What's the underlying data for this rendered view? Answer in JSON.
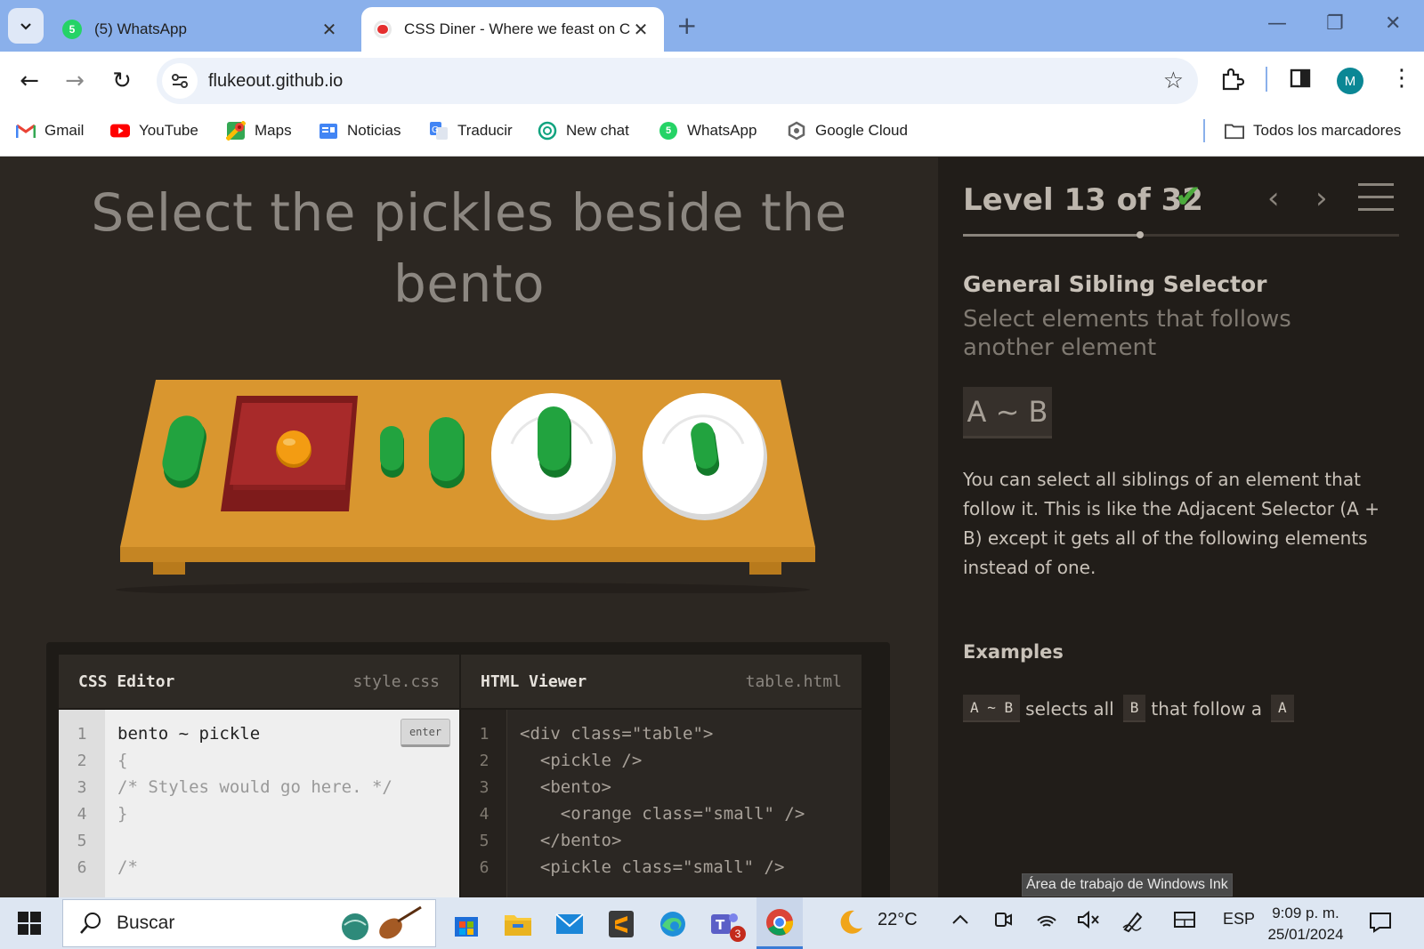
{
  "browser": {
    "tabs": [
      {
        "title": "(5) WhatsApp",
        "active": false,
        "badge": "5"
      },
      {
        "title": "CSS Diner - Where we feast on CSS Selectors!",
        "active": true
      }
    ],
    "new_tab_label": "+",
    "url": "flukeout.github.io",
    "profile_initial": "M",
    "bookmarks": [
      {
        "label": "Gmail",
        "icon": "gmail-icon"
      },
      {
        "label": "YouTube",
        "icon": "youtube-icon"
      },
      {
        "label": "Maps",
        "icon": "maps-icon"
      },
      {
        "label": "Noticias",
        "icon": "news-icon"
      },
      {
        "label": "Traducir",
        "icon": "translate-icon"
      },
      {
        "label": "New chat",
        "icon": "chatgpt-icon"
      },
      {
        "label": "WhatsApp",
        "icon": "whatsapp-icon"
      },
      {
        "label": "Google Cloud",
        "icon": "google-cloud-icon"
      }
    ],
    "all_bookmarks_label": "Todos los marcadores"
  },
  "game": {
    "order_text": "Select the pickles beside the bento",
    "table_items": [
      "pickle",
      "bento",
      "orange small",
      "pickle small",
      "pickle",
      "plate",
      "pickle",
      "plate",
      "pickle small"
    ],
    "editor": {
      "css_title": "CSS Editor",
      "css_file": "style.css",
      "html_title": "HTML Viewer",
      "html_file": "table.html",
      "enter_label": "enter",
      "css_lines": [
        "bento ~ pickle",
        "{",
        "/* Styles would go here. */",
        "}",
        "",
        "/*"
      ],
      "css_numbers": [
        "1",
        "2",
        "3",
        "4",
        "5",
        "6"
      ],
      "html_lines": [
        "<div class=\"table\">",
        "  <pickle />",
        "  <bento>",
        "    <orange class=\"small\" />",
        "  </bento>",
        "  <pickle class=\"small\" />"
      ],
      "html_numbers": [
        "1",
        "2",
        "3",
        "4",
        "5",
        "6"
      ]
    },
    "sidebar": {
      "level_text": "Level 13 of 32",
      "level_current": 13,
      "level_total": 32,
      "completed": true,
      "selector_name": "General Sibling Selector",
      "selector_title": "Select elements that follows another element",
      "syntax": "A ~ B",
      "hint": "You can select all siblings of an element that follow it. This is like the Adjacent Selector (A + B) except it gets all of the following elements instead of one.",
      "examples_title": "Examples",
      "example": {
        "code1": "A ~ B",
        "text1": "selects all",
        "code2": "B",
        "text2": "that follow a",
        "code3": "A"
      }
    },
    "ink_tooltip": "Área de trabajo de Windows Ink"
  },
  "taskbar": {
    "search_placeholder": "Buscar",
    "weather_temp": "22°C",
    "language": "ESP",
    "time": "9:09 p. m.",
    "date": "25/01/2024",
    "teams_badge": "3"
  },
  "colors": {
    "tabbar_bg": "#8ab0eb",
    "page_bg": "#2c2722",
    "sidebar_bg": "#211d19",
    "table_wood": "#d9962f",
    "bento_red": "#a82a2a",
    "pickle_green": "#1f9a3a",
    "check_green": "#4cab3c"
  }
}
